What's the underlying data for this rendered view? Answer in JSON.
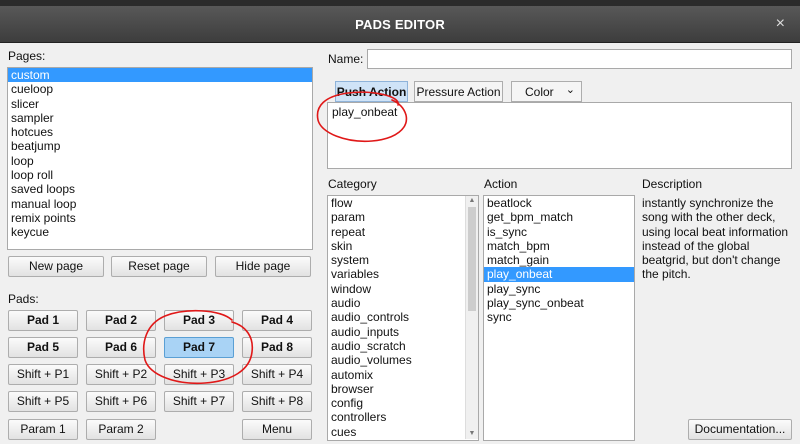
{
  "window": {
    "title": "PADS EDITOR",
    "close_glyph": "×"
  },
  "pages": {
    "label": "Pages:",
    "items": [
      "custom",
      "cueloop",
      "slicer",
      "sampler",
      "hotcues",
      "beatjump",
      "loop",
      "loop roll",
      "saved loops",
      "manual loop",
      "remix points",
      "keycue"
    ],
    "selected": "custom"
  },
  "page_buttons": {
    "new": "New page",
    "reset": "Reset page",
    "hide": "Hide page"
  },
  "pads": {
    "label": "Pads:",
    "rows": [
      [
        "Pad 1",
        "Pad 2",
        "Pad 3",
        "Pad 4"
      ],
      [
        "Pad 5",
        "Pad 6",
        "Pad 7",
        "Pad 8"
      ],
      [
        "Shift + P1",
        "Shift + P2",
        "Shift + P3",
        "Shift + P4"
      ],
      [
        "Shift + P5",
        "Shift + P6",
        "Shift + P7",
        "Shift + P8"
      ]
    ],
    "bottom": [
      "Param 1",
      "Param 2",
      "Menu"
    ],
    "selected": "Pad 7"
  },
  "name": {
    "label": "Name:",
    "value": ""
  },
  "tabs": {
    "push": "Push Action",
    "pressure": "Pressure Action",
    "color": "Color",
    "color_arrow": "⌄",
    "active": "Push Action"
  },
  "script": {
    "text": "play_onbeat"
  },
  "category": {
    "label": "Category",
    "items": [
      "flow",
      "param",
      "repeat",
      "skin",
      "system",
      "variables",
      "window",
      "audio",
      "audio_controls",
      "audio_inputs",
      "audio_scratch",
      "audio_volumes",
      "automix",
      "browser",
      "config",
      "controllers",
      "cues"
    ]
  },
  "action": {
    "label": "Action",
    "items": [
      "beatlock",
      "get_bpm_match",
      "is_sync",
      "match_bpm",
      "match_gain",
      "play_onbeat",
      "play_sync",
      "play_sync_onbeat",
      "sync"
    ],
    "selected": "play_onbeat"
  },
  "description": {
    "label": "Description",
    "text": "instantly synchronize the song with the other deck, using local beat information instead of the global beatgrid, but don't change the pitch."
  },
  "documentation_button": "Documentation...",
  "colors": {
    "annotation": "#e01818",
    "selection": "#3399ff",
    "titlebar": "#474747"
  }
}
